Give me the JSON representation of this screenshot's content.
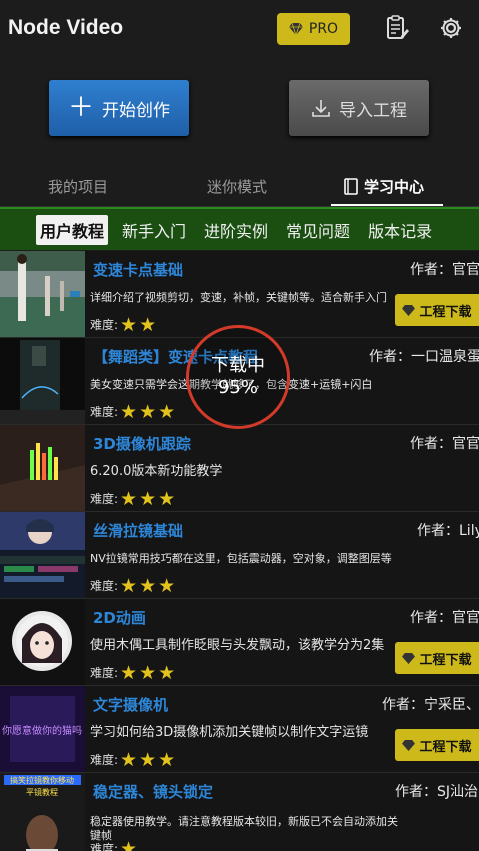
{
  "header": {
    "title": "Node Video",
    "pro_label": "PRO"
  },
  "actions": {
    "start": "开始创作",
    "import": "导入工程"
  },
  "main_tabs": [
    "我的项目",
    "迷你模式",
    "学习中心"
  ],
  "sub_tabs": [
    "用户教程",
    "新手入门",
    "进阶实例",
    "常见问题",
    "版本记录"
  ],
  "difficulty_label": "难度:",
  "download_label": "工程下载",
  "loading": {
    "text": "下载中",
    "percent": "95%",
    "progress": 0.95
  },
  "tutorials": [
    {
      "title": "变速卡点基础",
      "author": "作者：官官",
      "desc": "详细介绍了视频剪切，变速，补帧，关键帧等。适合新手入门",
      "stars": 2,
      "download": true
    },
    {
      "title": "【舞蹈类】变速卡点教程",
      "author": "作者：一口温泉蛋",
      "desc": "美女变速只需学会这期教学就够了，包含变速+运镜+闪白",
      "stars": 3,
      "download": false
    },
    {
      "title": "3D摄像机跟踪",
      "author": "作者：官官",
      "desc": "6.20.0版本新功能教学",
      "stars": 3,
      "download": false
    },
    {
      "title": "丝滑拉镜基础",
      "author": "作者：Lily",
      "desc": "NV拉镜常用技巧都在这里，包括震动器，空对象，调整图层等",
      "stars": 3,
      "download": false
    },
    {
      "title": "2D动画",
      "author": "作者：官官",
      "desc": "使用木偶工具制作眨眼与头发飘动，该教学分为2集",
      "stars": 3,
      "download": true
    },
    {
      "title": "文字摄像机",
      "author": "作者：宁采臣、",
      "desc": "学习如何给3D摄像机添加关键帧以制作文字运镜",
      "stars": 3,
      "download": true
    },
    {
      "title": "稳定器、镜头锁定",
      "author": "作者：SJ汕治",
      "desc": "稳定器使用教学。请注意教程版本较旧，新版已不会自动添加关",
      "desc2": "键帧",
      "stars": 1,
      "download": false
    }
  ],
  "thumb_texts": {
    "t7a": "搞笑拉镜教你移动",
    "t7b": "平镜教程",
    "t6": "你愿意做你的猫吗"
  },
  "colors": {
    "accent_gold": "#cdb91a",
    "title_blue": "#2d86d8",
    "subtab_green": "#1b4f12",
    "loading_red": "#d23a2a"
  }
}
